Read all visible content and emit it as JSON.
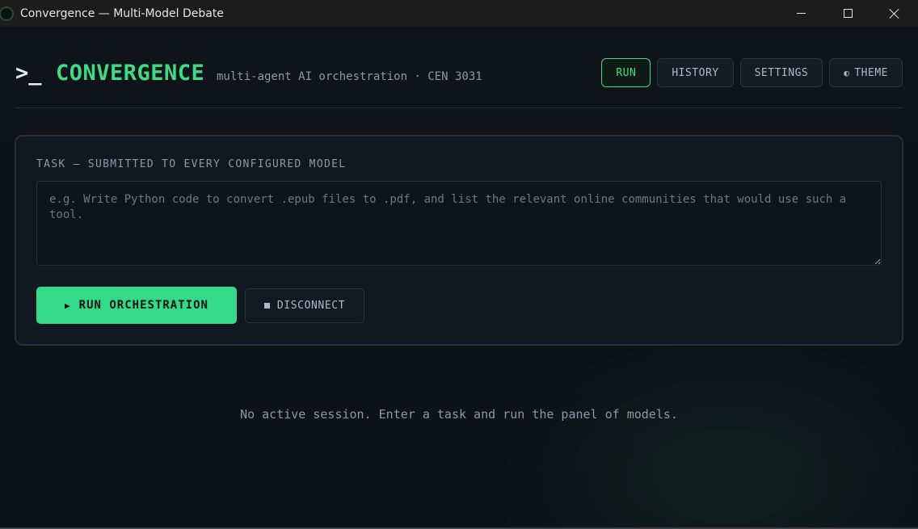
{
  "window": {
    "title": "Convergence — Multi-Model Debate"
  },
  "header": {
    "prompt": ">_",
    "brand": "CONVERGENCE",
    "subtitle": "multi-agent AI orchestration · CEN 3031"
  },
  "nav": {
    "items": [
      {
        "label": "RUN",
        "active": true
      },
      {
        "label": "HISTORY",
        "active": false
      },
      {
        "label": "SETTINGS",
        "active": false
      },
      {
        "label": "THEME",
        "active": false,
        "icon": "half-circle-icon"
      }
    ],
    "theme_glyph": "◐"
  },
  "task": {
    "label": "TASK — SUBMITTED TO EVERY CONFIGURED MODEL",
    "value": "",
    "placeholder": "e.g. Write Python code to convert .epub files to .pdf, and list the relevant online communities that would use such a tool."
  },
  "actions": {
    "run_label": "RUN ORCHESTRATION",
    "run_glyph": "▶",
    "disconnect_label": "DISCONNECT"
  },
  "empty_state": "No active session. Enter a task and run the panel of models.",
  "colors": {
    "accent": "#3ddc84",
    "background": "#0d1219",
    "panel": "#111820"
  }
}
